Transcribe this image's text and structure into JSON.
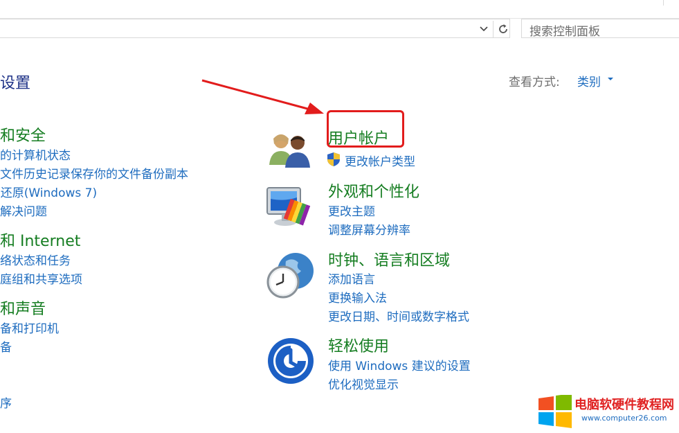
{
  "search": {
    "placeholder": "搜索控制面板"
  },
  "heading": {
    "title": "设置",
    "view_by_label": "查看方式:",
    "view_by_value": "类别"
  },
  "left_categories": [
    {
      "title": "和安全",
      "links": [
        "的计算机状态",
        "文件历史记录保存你的文件备份副本",
        "i还原(Windows 7)",
        "解决问题"
      ]
    },
    {
      "title": "和 Internet",
      "links": [
        "络状态和任务",
        "庭组和共享选项"
      ]
    },
    {
      "title": "和声音",
      "links": [
        "备和打印机",
        "备"
      ]
    },
    {
      "title": "",
      "links": [
        "序"
      ]
    }
  ],
  "right_categories": [
    {
      "title": "用户帐户",
      "icon": "users-icon",
      "links": [
        "更改帐户类型"
      ]
    },
    {
      "title": "外观和个性化",
      "icon": "appearance-icon",
      "links": [
        "更改主题",
        "调整屏幕分辨率"
      ]
    },
    {
      "title": "时钟、语言和区域",
      "icon": "clock-globe-icon",
      "links": [
        "添加语言",
        "更换输入法",
        "更改日期、时间或数字格式"
      ]
    },
    {
      "title": "轻松使用",
      "icon": "ease-of-access-icon",
      "links": [
        "使用 Windows 建议的设置",
        "优化视觉显示"
      ]
    }
  ],
  "watermark": {
    "title": "电脑软硬件教程网",
    "url": "www.computer26.com"
  },
  "colors": {
    "category": "#157d21",
    "link": "#1e6cbf",
    "heading": "#1e3287",
    "annotation": "#e21c1c"
  }
}
